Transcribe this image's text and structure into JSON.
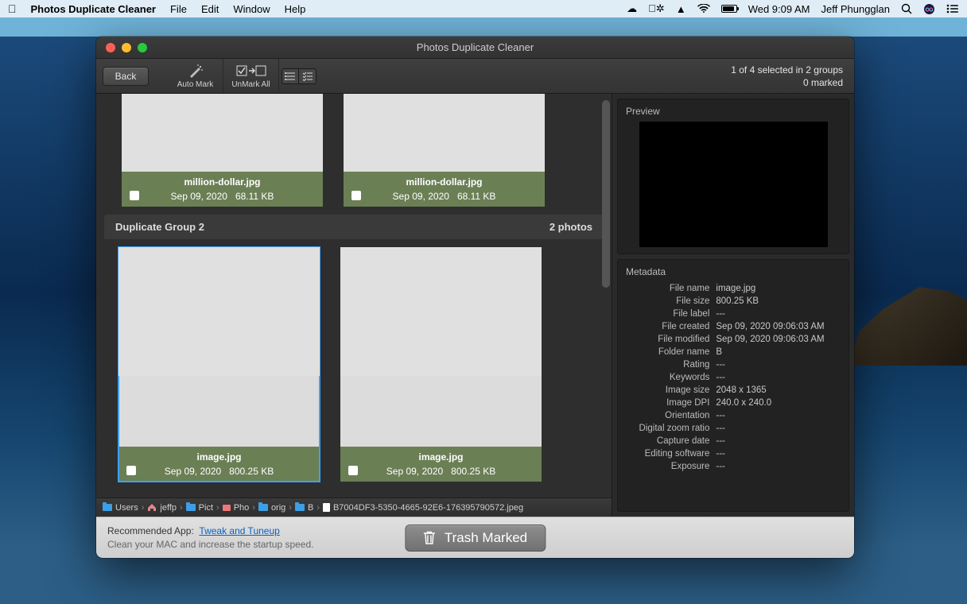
{
  "menubar": {
    "app_name": "Photos Duplicate Cleaner",
    "menus": [
      "File",
      "Edit",
      "Window",
      "Help"
    ],
    "clock": "Wed 9:09 AM",
    "user": "Jeff Phungglan"
  },
  "window": {
    "title": "Photos Duplicate Cleaner",
    "back": "Back",
    "tools": {
      "auto_mark": "Auto Mark",
      "unmark_all": "UnMark All"
    },
    "status_line1": "1 of 4 selected in 2 groups",
    "status_line2": "0 marked"
  },
  "top_group": {
    "items": [
      {
        "name": "million-dollar.jpg",
        "date": "Sep 09, 2020",
        "size": "68.11 KB"
      },
      {
        "name": "million-dollar.jpg",
        "date": "Sep 09, 2020",
        "size": "68.11 KB"
      }
    ]
  },
  "group2": {
    "title": "Duplicate Group 2",
    "count": "2 photos",
    "items": [
      {
        "name": "image.jpg",
        "date": "Sep 09, 2020",
        "size": "800.25 KB",
        "selected": true
      },
      {
        "name": "image.jpg",
        "date": "Sep 09, 2020",
        "size": "800.25 KB",
        "selected": false
      }
    ]
  },
  "crumbs": [
    "Users",
    "jeffp",
    "Pict",
    "Pho",
    "orig",
    "B",
    "B7004DF3-5350-4665-92E6-176395790572.jpeg"
  ],
  "preview": {
    "title": "Preview"
  },
  "metadata": {
    "title": "Metadata",
    "rows": [
      {
        "k": "File name",
        "v": "image.jpg"
      },
      {
        "k": "File size",
        "v": "800.25 KB"
      },
      {
        "k": "File label",
        "v": "---"
      },
      {
        "k": "File created",
        "v": "Sep 09, 2020 09:06:03 AM"
      },
      {
        "k": "File modified",
        "v": "Sep 09, 2020 09:06:03 AM"
      },
      {
        "k": "Folder name",
        "v": "B"
      },
      {
        "k": "Rating",
        "v": "---"
      },
      {
        "k": "Keywords",
        "v": "---"
      },
      {
        "k": "Image size",
        "v": "2048 x 1365"
      },
      {
        "k": "Image DPI",
        "v": "240.0 x 240.0"
      },
      {
        "k": "Orientation",
        "v": "---"
      },
      {
        "k": "Digital zoom ratio",
        "v": "---"
      },
      {
        "k": "Capture date",
        "v": "---"
      },
      {
        "k": "Editing software",
        "v": "---"
      },
      {
        "k": "Exposure",
        "v": "---"
      }
    ]
  },
  "footer": {
    "rec_label": "Recommended App:",
    "rec_link": "Tweak and Tuneup",
    "rec_sub": "Clean your MAC and increase the startup speed.",
    "trash": "Trash Marked"
  }
}
